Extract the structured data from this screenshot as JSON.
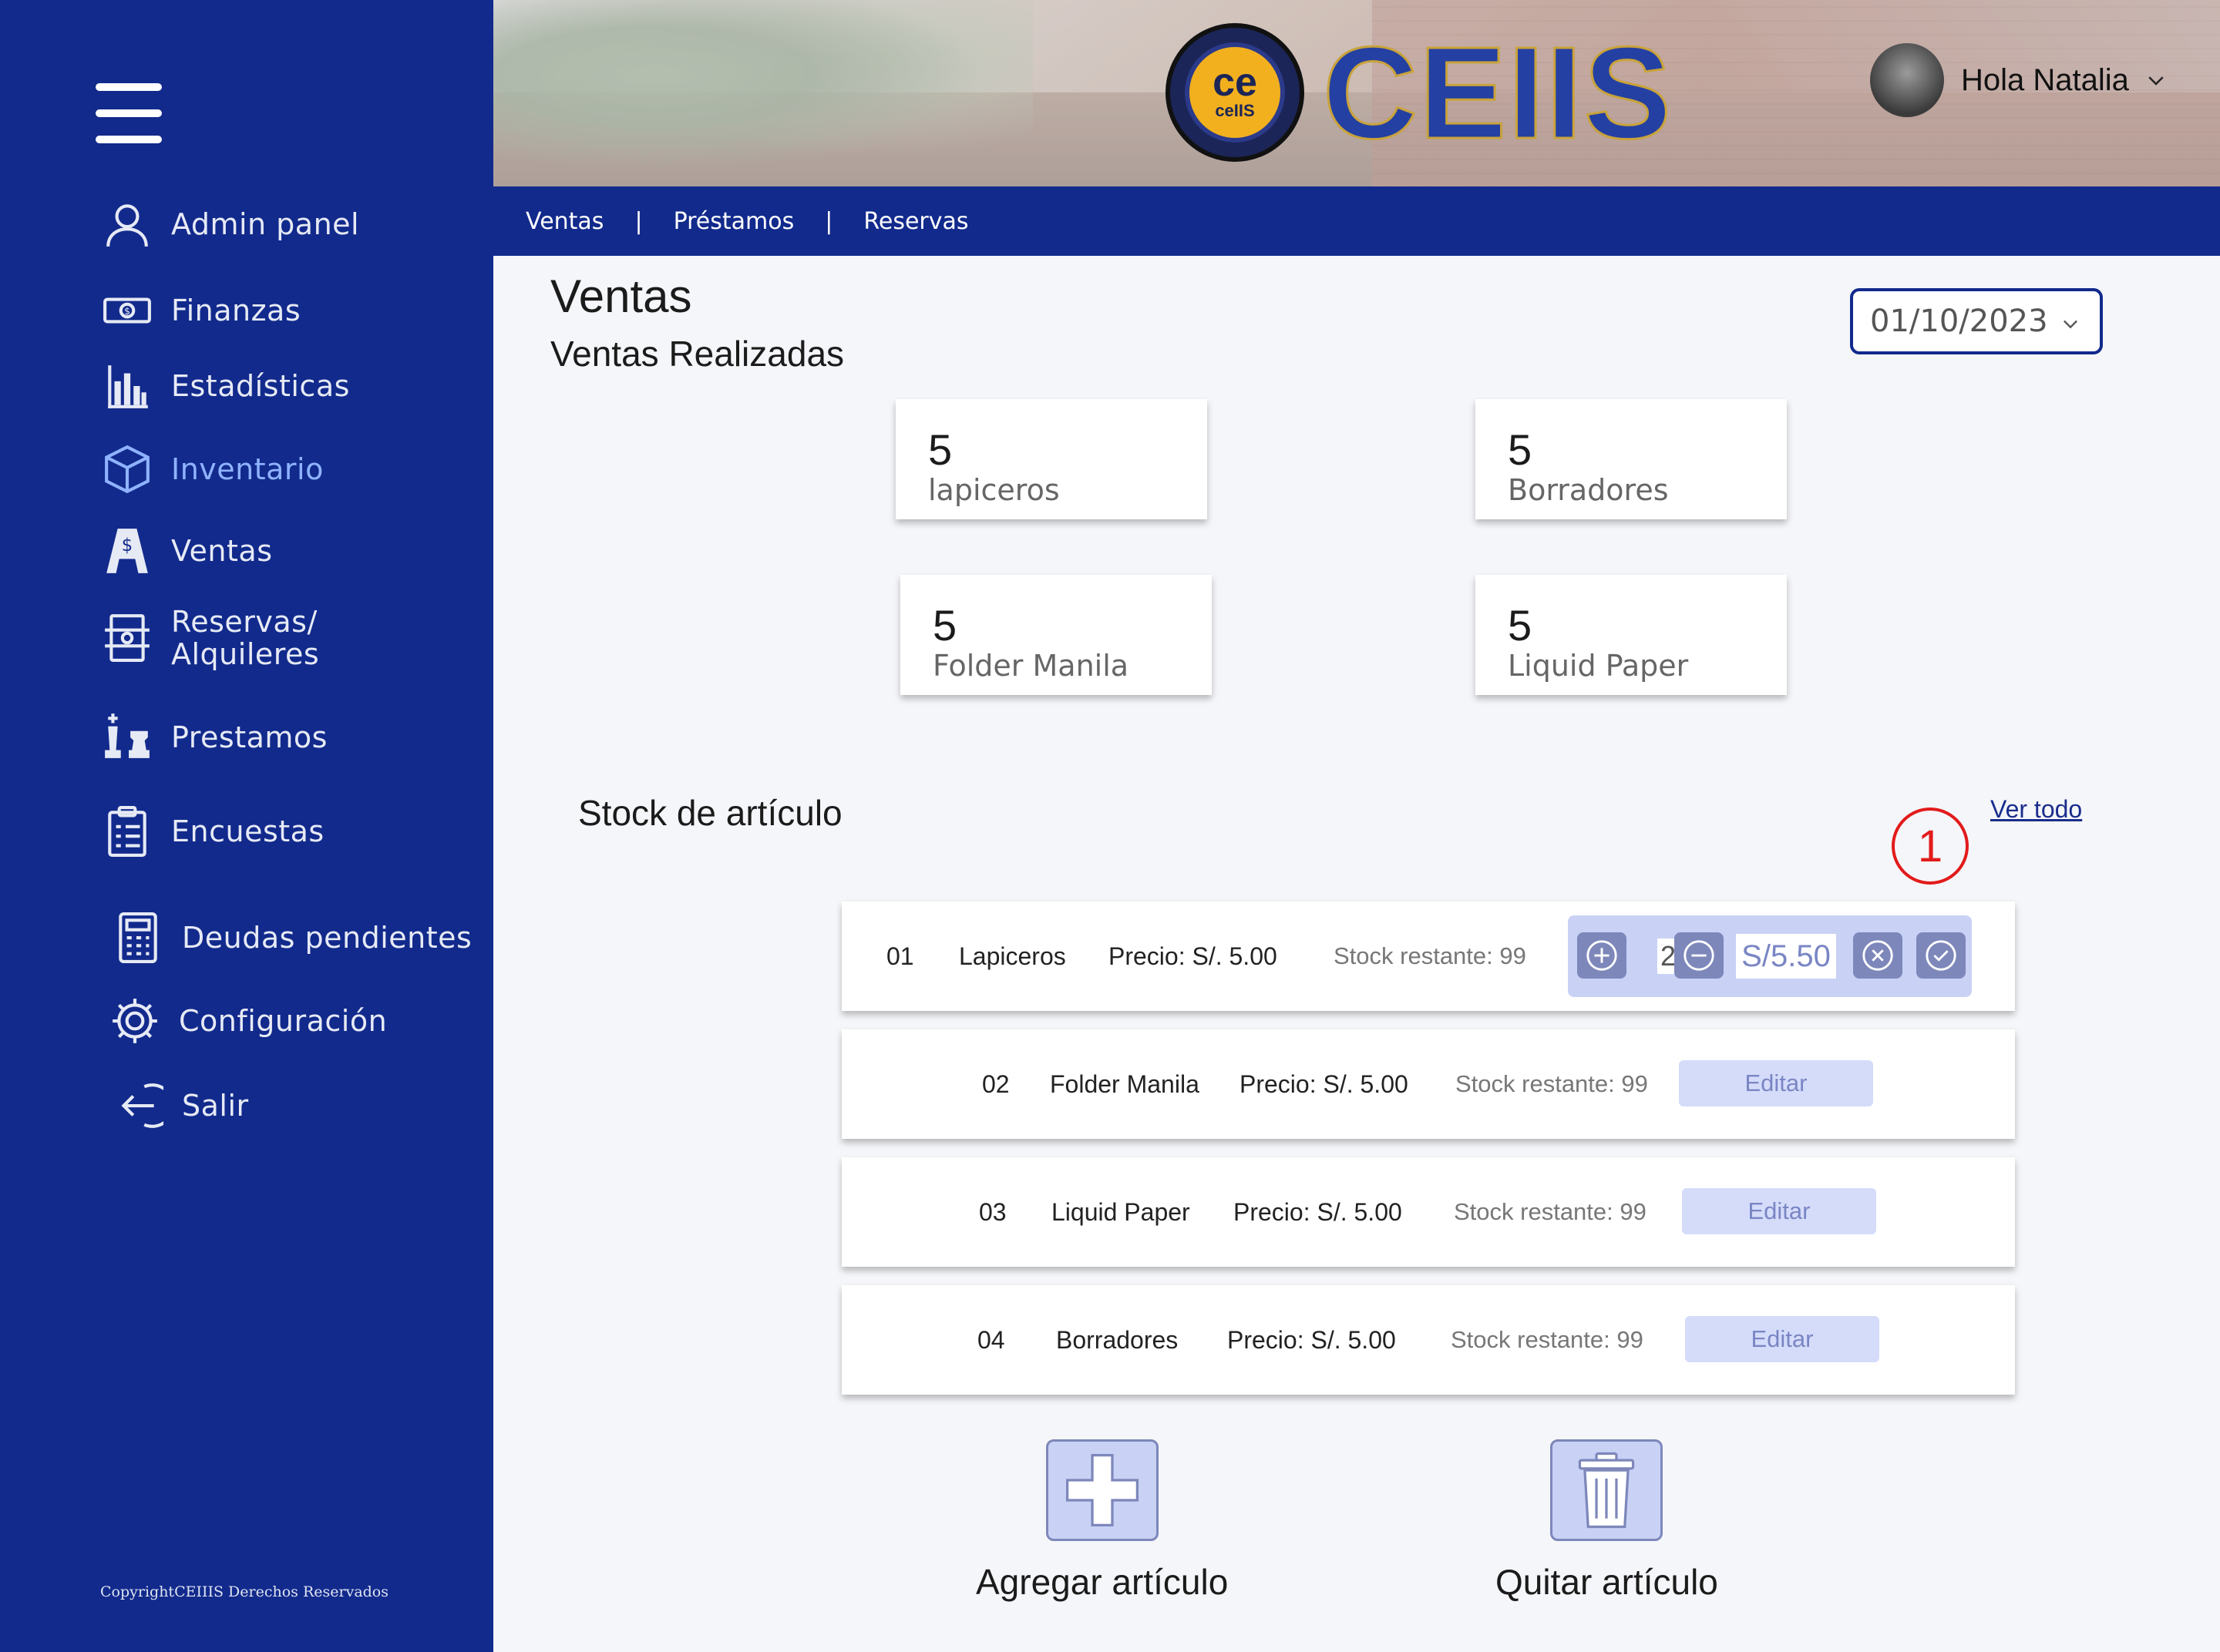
{
  "sidebar": {
    "items": [
      {
        "name": "sidebar-item-admin-panel",
        "icon": "user-icon",
        "label": "Admin panel",
        "active": false
      },
      {
        "name": "sidebar-item-finanzas",
        "icon": "money-icon",
        "label": "Finanzas",
        "active": false
      },
      {
        "name": "sidebar-item-estadisticas",
        "icon": "bar-chart-icon",
        "label": "Estadísticas",
        "active": false
      },
      {
        "name": "sidebar-item-inventario",
        "icon": "box-icon",
        "label": "Inventario",
        "active": true
      },
      {
        "name": "sidebar-item-ventas",
        "icon": "sales-icon",
        "label": "Ventas",
        "active": false
      },
      {
        "name": "sidebar-item-reservas",
        "icon": "foosball-icon",
        "label": "Reservas/",
        "label2": "Alquileres",
        "active": false
      },
      {
        "name": "sidebar-item-prestamos",
        "icon": "chess-icon",
        "label": "Prestamos",
        "active": false
      },
      {
        "name": "sidebar-item-encuestas",
        "icon": "clipboard-icon",
        "label": "Encuestas",
        "active": false
      },
      {
        "name": "sidebar-item-deudas",
        "icon": "calculator-icon",
        "label": "Deudas pendientes",
        "active": false
      },
      {
        "name": "sidebar-item-configuracion",
        "icon": "gear-icon",
        "label": "Configuración",
        "active": false
      },
      {
        "name": "sidebar-item-salir",
        "icon": "logout-icon",
        "label": "Salir",
        "active": false
      }
    ],
    "copyright": "CopyrightCEIIIS Derechos Reservados"
  },
  "header": {
    "brand": "CEIIS",
    "logo_text": "ce",
    "logo_sub": "ceIIS",
    "user_greeting": "Hola Natalia",
    "subnav": [
      "Ventas",
      "Préstamos",
      "Reservas"
    ]
  },
  "main": {
    "title": "Ventas",
    "subtitle": "Ventas Realizadas",
    "date": "01/10/2023",
    "summary_cards": [
      {
        "count": "5",
        "label": "lapiceros"
      },
      {
        "count": "5",
        "label": "Borradores"
      },
      {
        "count": "5",
        "label": "Folder Manila"
      },
      {
        "count": "5",
        "label": "Liquid Paper"
      }
    ],
    "stock_title": "Stock de artículo",
    "ver_todo": "Ver todo",
    "marker": "1",
    "rows": [
      {
        "id": "01",
        "name": "Lapiceros",
        "price": "Precio: S/. 5.00",
        "stock": "Stock restante: 99",
        "qty": "2",
        "total": "S/5.50"
      },
      {
        "id": "02",
        "name": "Folder Manila",
        "price": "Precio: S/. 5.00",
        "stock": "Stock restante: 99",
        "edit": "Editar"
      },
      {
        "id": "03",
        "name": "Liquid Paper",
        "price": "Precio: S/. 5.00",
        "stock": "Stock restante: 99",
        "edit": "Editar"
      },
      {
        "id": "04",
        "name": "Borradores",
        "price": "Precio: S/. 5.00",
        "stock": "Stock restante: 99",
        "edit": "Editar"
      }
    ],
    "add_label": "Agregar artículo",
    "remove_label": "Quitar artículo"
  },
  "colors": {
    "sidebar": "#122a8c",
    "active_item": "#8fb3ff",
    "button_fill": "#d5dcfa",
    "accent_dark": "#7d87ba",
    "marker": "#e21b1b"
  }
}
